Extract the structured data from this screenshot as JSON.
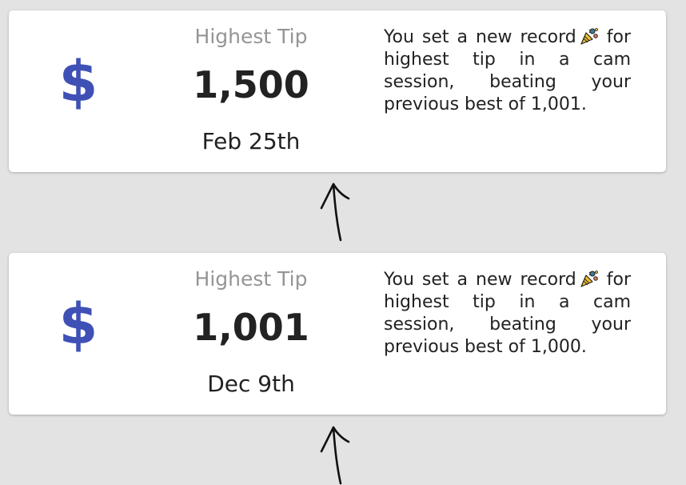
{
  "theme": {
    "accent": "#3f51b5",
    "card_bg": "#ffffff",
    "page_bg": "#e3e3e3",
    "muted_text": "#959595",
    "text": "#222222"
  },
  "records": [
    {
      "icon": "dollar-icon",
      "icon_char": "$",
      "label": "Highest Tip",
      "value": "1,500",
      "date": "Feb 25th",
      "message": "You set a new record",
      "message_icon": "party-popper-icon",
      "message_rest": "for highest tip in a cam session, beating your previous best of 1,001."
    },
    {
      "icon": "dollar-icon",
      "icon_char": "$",
      "label": "Highest Tip",
      "value": "1,001",
      "date": "Dec 9th",
      "message": "You set a new record",
      "message_icon": "party-popper-icon",
      "message_rest": "for highest tip in a cam session, beating your previous best of 1,000."
    }
  ],
  "connectors": [
    {
      "icon": "up-arrow-icon"
    },
    {
      "icon": "up-arrow-icon"
    }
  ]
}
